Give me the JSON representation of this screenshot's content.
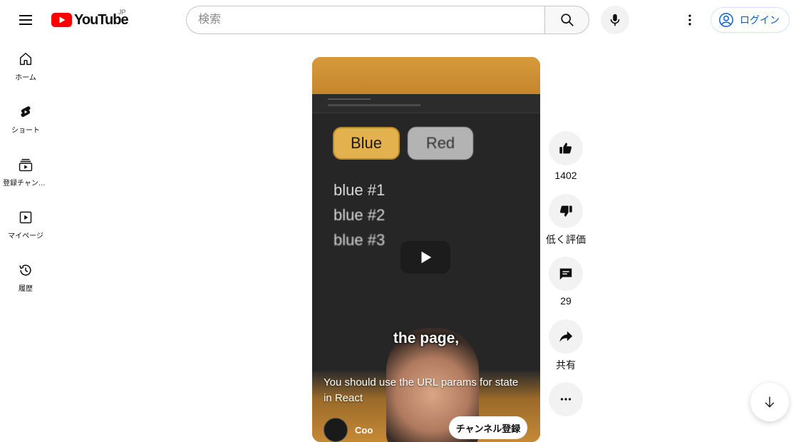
{
  "header": {
    "logo_text": "YouTube",
    "region": "JP",
    "search_placeholder": "検索",
    "login_label": "ログイン"
  },
  "sidebar": {
    "items": [
      {
        "label": "ホーム",
        "icon": "home-icon"
      },
      {
        "label": "ショート",
        "icon": "shorts-icon"
      },
      {
        "label": "登録チャンネル",
        "icon": "subscriptions-icon"
      },
      {
        "label": "マイページ",
        "icon": "my-page-icon"
      },
      {
        "label": "履歴",
        "icon": "history-icon"
      }
    ]
  },
  "video": {
    "pill_blue": "Blue",
    "pill_red": "Red",
    "list": [
      "blue #1",
      "blue #2",
      "blue #3"
    ],
    "caption": "the page,",
    "title": "You should use the URL params for state in React",
    "channel_name": "Coo",
    "subscribe_label": "チャンネル登録"
  },
  "actions": {
    "like_count": "1402",
    "dislike_label": "低く評価",
    "comment_count": "29",
    "share_label": "共有"
  },
  "colors": {
    "brand_red": "#ff0000",
    "link_blue": "#065fd4"
  }
}
